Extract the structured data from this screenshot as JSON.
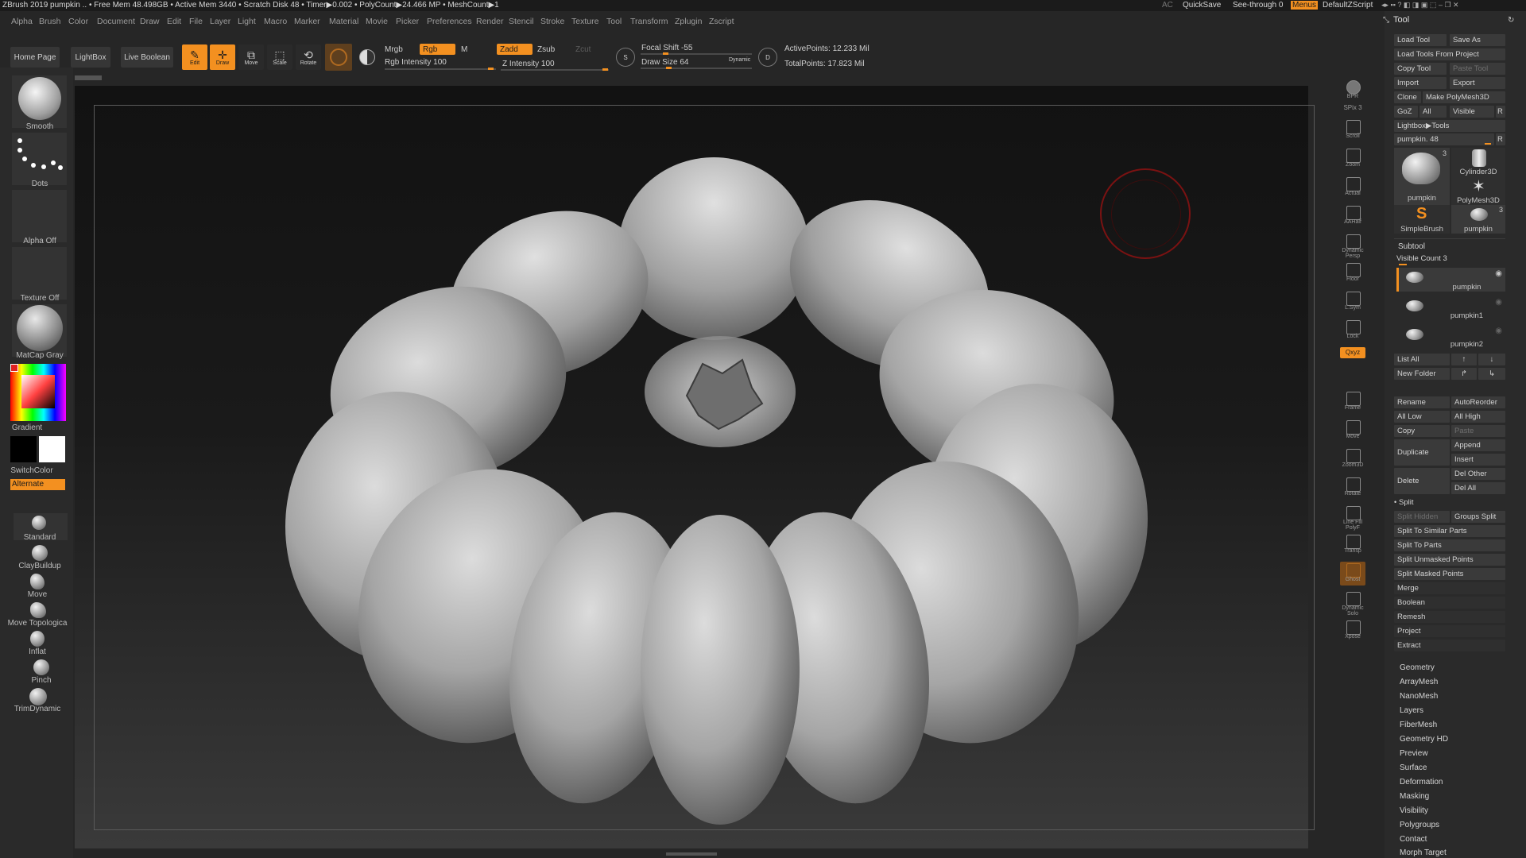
{
  "titlebar": {
    "left_text": "ZBrush 2019    pumpkin    ..  • Free Mem 48.498GB • Active Mem 3440 • Scratch Disk 48 • Timer▶0.002 • PolyCount▶24.466 MP • MeshCount▶1",
    "ac": "AC",
    "quicksave": "QuickSave",
    "see_through": "See-through   0",
    "menus": "Menus",
    "script": "DefaultZScript"
  },
  "menus": [
    "Alpha",
    "Brush",
    "Color",
    "Document",
    "Draw",
    "Edit",
    "File",
    "Layer",
    "Light",
    "Macro",
    "Marker",
    "Material",
    "Movie",
    "Picker",
    "Preferences",
    "Render",
    "Stencil",
    "Stroke",
    "Texture",
    "Tool",
    "Transform",
    "Zplugin",
    "Zscript"
  ],
  "toolbar": {
    "home_page": "Home Page",
    "lightbox": "LightBox",
    "live_boolean": "Live Boolean",
    "edit": "Edit",
    "draw": "Draw",
    "move": "Move",
    "scale": "Scale",
    "rotate": "Rotate",
    "mrgb": "Mrgb",
    "rgb": "Rgb",
    "m": "M",
    "zadd": "Zadd",
    "zsub": "Zsub",
    "zcut": "Zcut",
    "rgb_intensity": "Rgb Intensity 100",
    "z_intensity": "Z Intensity 100",
    "focal_shift": "Focal Shift -55",
    "draw_size": "Draw Size 64",
    "dynamic": "Dynamic",
    "active_points": "ActivePoints: 12.233 Mil",
    "total_points": "TotalPoints: 17.823 Mil"
  },
  "left_shelf": {
    "brush": "Smooth",
    "stroke": "Dots",
    "alpha": "Alpha Off",
    "texture": "Texture Off",
    "material": "MatCap Gray",
    "gradient": "Gradient",
    "switchcolor": "SwitchColor",
    "alternate": "Alternate",
    "brushes": [
      "Standard",
      "ClayBuildup",
      "Move",
      "Move Topologica",
      "Inflat",
      "Pinch",
      "TrimDynamic"
    ]
  },
  "right_shelf": [
    "BPR",
    "SPix 3",
    "Scroll",
    "Zoom",
    "Actual",
    "AAHalf",
    "Dynamic Persp",
    "Floor",
    "L.Sym",
    "Lock",
    "Qxyz",
    "Frame",
    "Move",
    "Zoom3D",
    "Rotate",
    "Line Fill PolyF",
    "Transp",
    "Ghost",
    "Dynamic Solo",
    "Xpose"
  ],
  "tool_panel": {
    "title": "Tool",
    "load_tool": "Load Tool",
    "save_as": "Save As",
    "load_tools_from_project": "Load Tools From Project",
    "copy_tool": "Copy Tool",
    "paste_tool": "Paste Tool",
    "import": "Import",
    "export": "Export",
    "clone": "Clone",
    "make_polymesh": "Make PolyMesh3D",
    "goz": "GoZ",
    "all": "All",
    "visible": "Visible",
    "r": "R",
    "lightbox_tools": "Lightbox▶Tools",
    "current_tool": "pumpkin. 48",
    "thumbs": [
      {
        "label": "pumpkin",
        "badge": "3"
      },
      {
        "label": "Cylinder3D",
        "badge": ""
      },
      {
        "label": "PolyMesh3D",
        "badge": ""
      },
      {
        "label": "SimpleBrush",
        "badge": ""
      },
      {
        "label": "pumpkin",
        "badge": "3"
      }
    ],
    "subtool": "Subtool",
    "visible_count": "Visible Count 3",
    "subtools": [
      "pumpkin",
      "pumpkin1",
      "pumpkin2"
    ],
    "list_all": "List All",
    "new_folder": "New Folder",
    "rename": "Rename",
    "autoreorder": "AutoReorder",
    "all_low": "All Low",
    "all_high": "All High",
    "copy": "Copy",
    "paste": "Paste",
    "duplicate": "Duplicate",
    "append": "Append",
    "insert": "Insert",
    "delete": "Delete",
    "del_other": "Del Other",
    "del_all": "Del All",
    "split": "Split",
    "split_hidden": "Split Hidden",
    "groups_split": "Groups Split",
    "split_buttons": [
      "Split To Similar Parts",
      "Split To Parts",
      "Split Unmasked Points",
      "Split Masked Points"
    ],
    "subtool_sections": [
      "Merge",
      "Boolean",
      "Remesh",
      "Project",
      "Extract"
    ],
    "sections": [
      "Geometry",
      "ArrayMesh",
      "NanoMesh",
      "Layers",
      "FiberMesh",
      "Geometry HD",
      "Preview",
      "Surface",
      "Deformation",
      "Masking",
      "Visibility",
      "Polygroups",
      "Contact",
      "Morph Target"
    ]
  },
  "colors": {
    "accent": "#f39020",
    "panel": "#2a2a2a",
    "button": "#3a3a3a"
  }
}
